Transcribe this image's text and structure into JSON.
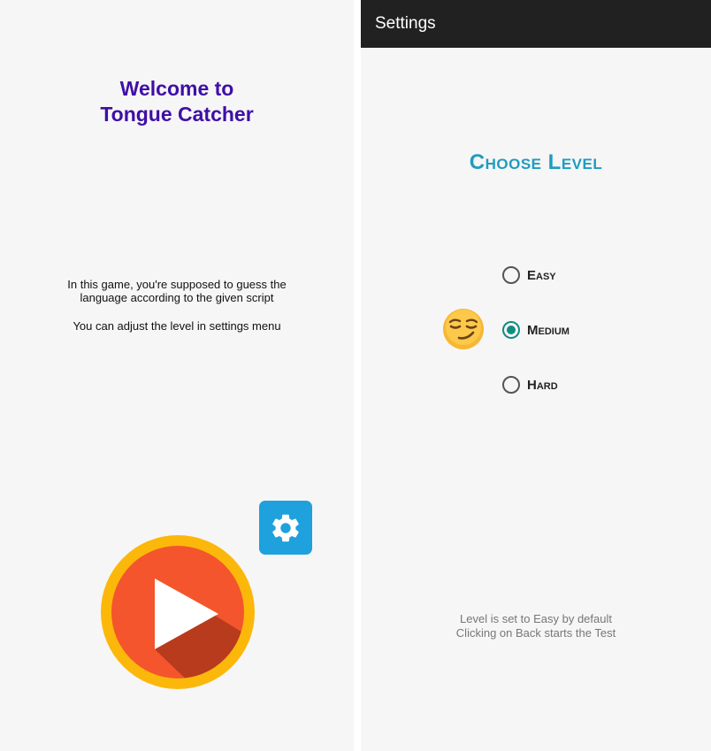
{
  "home": {
    "welcome_line1": "Welcome to",
    "welcome_line2": "Tongue Catcher",
    "desc_line1": "In this game, you're supposed to guess the language according to the given script",
    "desc_line2": "You can adjust the level in settings menu",
    "settings_icon": "gear-icon",
    "play_icon": "play-icon"
  },
  "settings": {
    "title": "Settings",
    "heading": "Choose Level",
    "levels": [
      {
        "label": "Easy",
        "checked": false
      },
      {
        "label": "Medium",
        "checked": true
      },
      {
        "label": "Hard",
        "checked": false
      }
    ],
    "footer_line1": "Level is set to Easy by default",
    "footer_line2": "Clicking on Back starts the Test",
    "emoji": "smirking-face"
  },
  "colors": {
    "welcome": "#3f0fa6",
    "accent_blue": "#1ea1dc",
    "heading": "#1e9cc0",
    "radio_checked": "#0f8d80",
    "play_ring": "#fbb80b",
    "play_fill": "#f4552c",
    "appbar": "#212121"
  }
}
